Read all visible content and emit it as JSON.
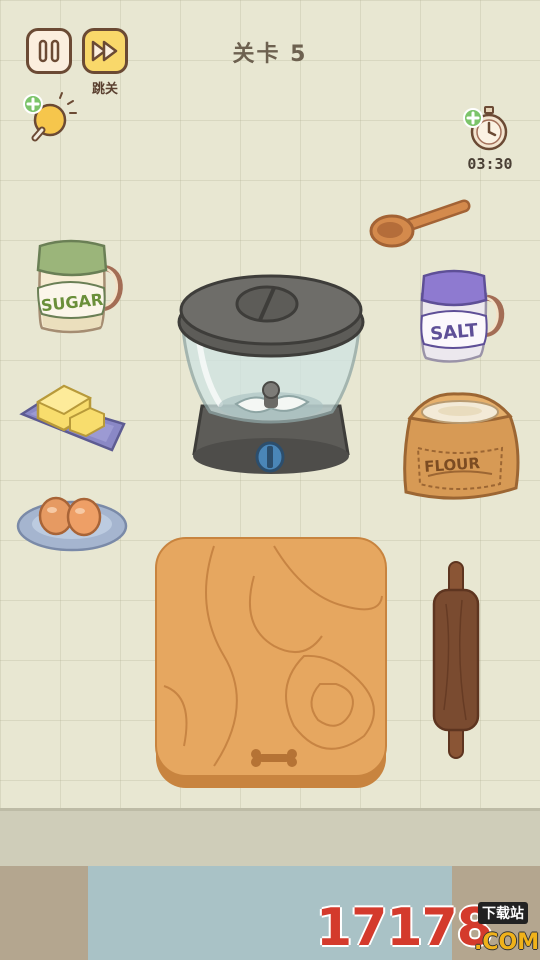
{
  "hud": {
    "level_title": "关卡 5",
    "skip_label": "跳关",
    "timer": "03:30",
    "icons": {
      "pause": "pause-icon",
      "skip": "fast-forward-icon",
      "hint": "lightbulb-icon",
      "add_time": "stopwatch-icon"
    }
  },
  "items": {
    "sugar_label": "SUGAR",
    "salt_label": "SALT",
    "flour_label": "FLOUR"
  },
  "watermark": {
    "number": "17178",
    "site": "下载站",
    "com": ".COM"
  },
  "colors": {
    "floor": "#e8e7d2",
    "board": "#e6a760",
    "blender": "#5d5c58",
    "sugar_lid": "#9bb57a",
    "salt_lid": "#8e7ad0",
    "sack": "#d79a55",
    "pin": "#7a4b30"
  }
}
